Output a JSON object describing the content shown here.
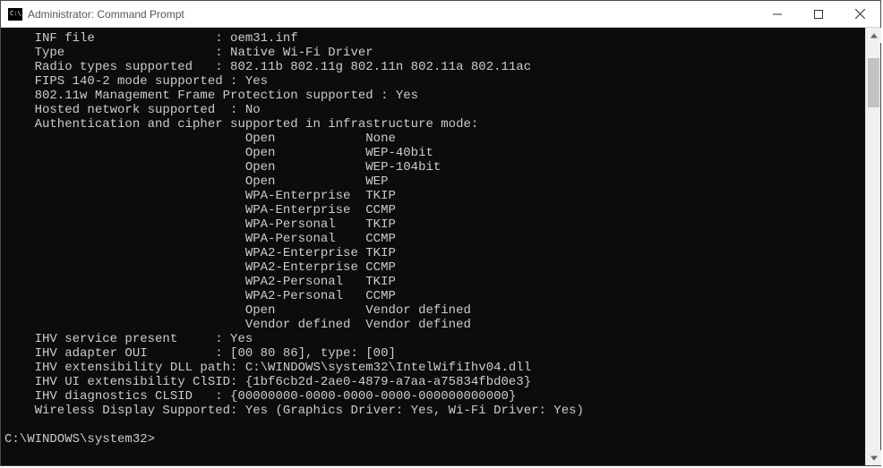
{
  "window": {
    "title": "Administrator: Command Prompt"
  },
  "kv": {
    "inf_file": {
      "label": "INF file",
      "value": "oem31.inf"
    },
    "type": {
      "label": "Type",
      "value": "Native Wi-Fi Driver"
    },
    "radio": {
      "label": "Radio types supported",
      "value": "802.11b 802.11g 802.11n 802.11a 802.11ac"
    },
    "fips": {
      "label": "FIPS 140-2 mode supported",
      "value": "Yes"
    },
    "mfp": {
      "label": "802.11w Management Frame Protection supported",
      "value": "Yes"
    },
    "hosted": {
      "label": "Hosted network supported",
      "value": "No"
    },
    "auth_header": {
      "label": "Authentication and cipher supported in infrastructure mode:"
    },
    "ihv_present": {
      "label": "IHV service present",
      "value": "Yes"
    },
    "ihv_oui": {
      "label": "IHV adapter OUI",
      "value": "[00 80 86], type: [00]"
    },
    "ihv_dll": {
      "label": "IHV extensibility DLL path",
      "value": "C:\\WINDOWS\\system32\\IntelWifiIhv04.dll"
    },
    "ihv_ui": {
      "label": "IHV UI extensibility ClSID",
      "value": "{1bf6cb2d-2ae0-4879-a7aa-a75834fbd0e3}"
    },
    "ihv_diag": {
      "label": "IHV diagnostics CLSID",
      "value": "{00000000-0000-0000-0000-000000000000}"
    },
    "wdisplay": {
      "label": "Wireless Display Supported",
      "value": "Yes (Graphics Driver: Yes, Wi-Fi Driver: Yes)"
    }
  },
  "auth_pairs": [
    {
      "auth": "Open",
      "cipher": "None"
    },
    {
      "auth": "Open",
      "cipher": "WEP-40bit"
    },
    {
      "auth": "Open",
      "cipher": "WEP-104bit"
    },
    {
      "auth": "Open",
      "cipher": "WEP"
    },
    {
      "auth": "WPA-Enterprise",
      "cipher": "TKIP"
    },
    {
      "auth": "WPA-Enterprise",
      "cipher": "CCMP"
    },
    {
      "auth": "WPA-Personal",
      "cipher": "TKIP"
    },
    {
      "auth": "WPA-Personal",
      "cipher": "CCMP"
    },
    {
      "auth": "WPA2-Enterprise",
      "cipher": "TKIP"
    },
    {
      "auth": "WPA2-Enterprise",
      "cipher": "CCMP"
    },
    {
      "auth": "WPA2-Personal",
      "cipher": "TKIP"
    },
    {
      "auth": "WPA2-Personal",
      "cipher": "CCMP"
    },
    {
      "auth": "Open",
      "cipher": "Vendor defined"
    },
    {
      "auth": "Vendor defined",
      "cipher": "Vendor defined"
    }
  ],
  "prompt": "C:\\WINDOWS\\system32>"
}
